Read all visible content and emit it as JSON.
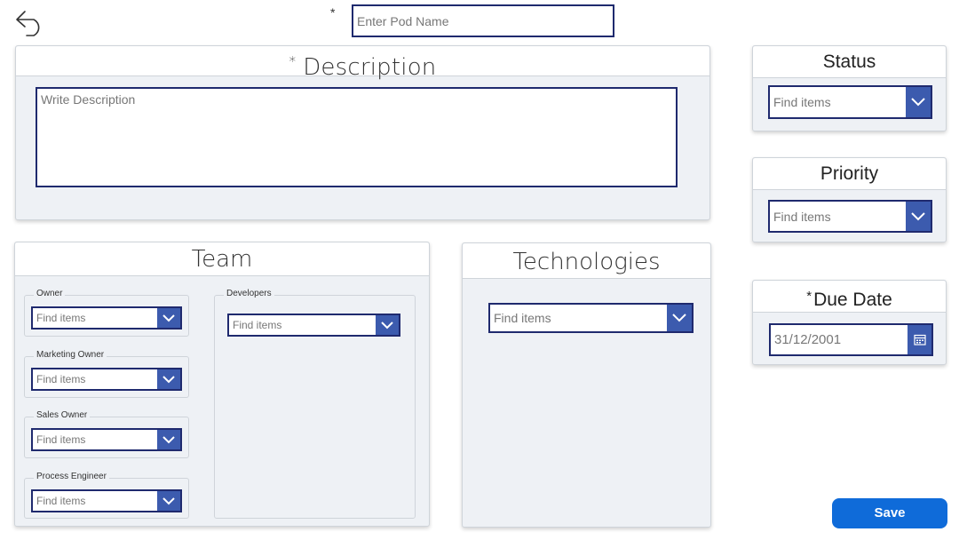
{
  "form": {
    "back_icon": "back-arrow-icon",
    "required_mark": "*",
    "pod_name_placeholder": "Enter Pod Name"
  },
  "description": {
    "title": "Description",
    "placeholder": "Write Description"
  },
  "team": {
    "title": "Team",
    "owner": {
      "label": "Owner",
      "placeholder": "Find items"
    },
    "marketing_owner": {
      "label": "Marketing Owner",
      "placeholder": "Find items"
    },
    "sales_owner": {
      "label": "Sales Owner",
      "placeholder": "Find items"
    },
    "process_engineer": {
      "label": "Process Engineer",
      "placeholder": "Find items"
    },
    "developers": {
      "label": "Developers",
      "placeholder": "Find items"
    }
  },
  "technologies": {
    "title": "Technologies",
    "placeholder": "Find items"
  },
  "status": {
    "title": "Status",
    "placeholder": "Find items"
  },
  "priority": {
    "title": "Priority",
    "placeholder": "Find items"
  },
  "due_date": {
    "title": "Due Date",
    "value": "31/12/2001",
    "icon": "calendar-icon"
  },
  "actions": {
    "save_label": "Save"
  },
  "colors": {
    "accent": "#3c5bae",
    "border": "#1f2a6e",
    "save": "#0f6bd9",
    "card_bg": "#eef1f5"
  }
}
